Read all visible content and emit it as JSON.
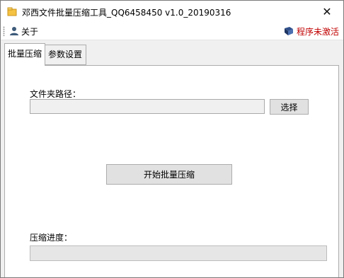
{
  "window": {
    "title": "邓西文件批量压缩工具_QQ6458450 v1.0_20190316",
    "close_glyph": "✕"
  },
  "menubar": {
    "about_label": "关于",
    "status_label": "程序未激活",
    "status_color": "#c00000"
  },
  "tabs": [
    {
      "label": "批量压缩",
      "active": true
    },
    {
      "label": "参数设置",
      "active": false
    }
  ],
  "main": {
    "folder_path_label": "文件夹路径：",
    "folder_path_value": "",
    "select_button": "选择",
    "start_button": "开始批量压缩",
    "progress_label": "压缩进度：",
    "progress_fraction": 0
  },
  "icons": {
    "app": "app-icon",
    "about": "user-icon",
    "status": "book-icon"
  }
}
